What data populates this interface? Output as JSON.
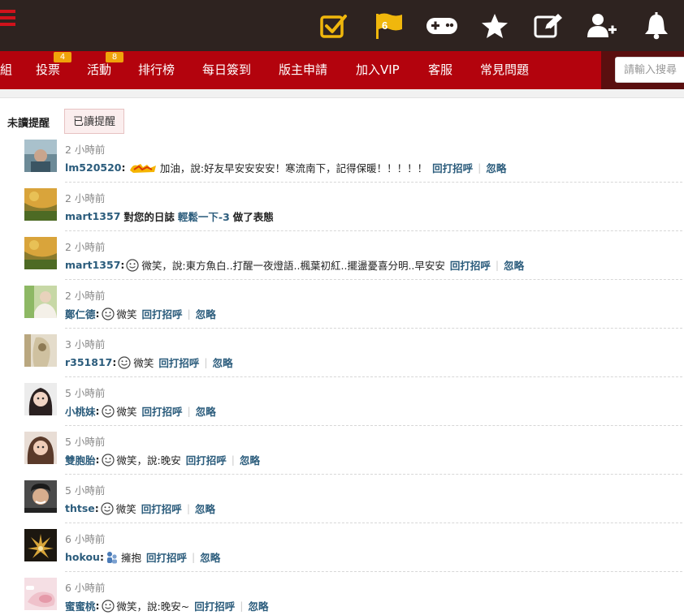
{
  "topbar": {
    "flag_count": "6",
    "icons": [
      "checkbox-icon",
      "flag-icon",
      "gamepad-icon",
      "star-icon",
      "edit-icon",
      "add-user-icon",
      "bell-icon"
    ]
  },
  "nav": {
    "items": [
      {
        "label": "組"
      },
      {
        "label": "投票",
        "badge": "4"
      },
      {
        "label": "活動",
        "badge": "8"
      },
      {
        "label": "排行榜"
      },
      {
        "label": "每日簽到"
      },
      {
        "label": "版主申請"
      },
      {
        "label": "加入VIP"
      },
      {
        "label": "客服"
      },
      {
        "label": "常見問題"
      }
    ],
    "search_placeholder": "請輸入搜尋"
  },
  "tabs": {
    "unread": "未讀提醒",
    "read": "已讀提醒"
  },
  "actions": {
    "reply": "回打招呼",
    "ignore": "忽略"
  },
  "notifications": [
    {
      "time": "2 小時前",
      "user": "lm520520",
      "pre": "",
      "action_icon": "jiayou",
      "text": "加油，說:好友早安安安安！寒流南下，記得保暖！！！！！",
      "has_reply": true
    },
    {
      "time": "2 小時前",
      "user": "mart1357",
      "diary": true,
      "pre": "對您的日誌",
      "diary_link": "輕鬆一下-3",
      "post": "做了表態"
    },
    {
      "time": "2 小時前",
      "user": "mart1357",
      "action_icon": "smile",
      "text": "微笑，說:東方魚白..打醒一夜燈語..楓葉初紅..擺盪憂喜分明..早安安",
      "has_reply": true
    },
    {
      "time": "2 小時前",
      "user": "鄭仁德",
      "action_icon": "smile",
      "text": "微笑",
      "has_reply": true
    },
    {
      "time": "3 小時前",
      "user": "r351817",
      "action_icon": "smile",
      "text": "微笑",
      "has_reply": true
    },
    {
      "time": "5 小時前",
      "user": "小桃妹",
      "action_icon": "smile",
      "text": "微笑",
      "has_reply": true
    },
    {
      "time": "5 小時前",
      "user": "雙胞胎",
      "action_icon": "smile",
      "text": "微笑，說:晚安",
      "has_reply": true
    },
    {
      "time": "5 小時前",
      "user": "thtse",
      "action_icon": "smile",
      "text": "微笑",
      "has_reply": true
    },
    {
      "time": "6 小時前",
      "user": "hokou",
      "action_icon": "hug",
      "text": "擁抱",
      "has_reply": true
    },
    {
      "time": "6 小時前",
      "user": "蜜蜜桃",
      "action_icon": "smile",
      "text": "微笑，說:晚安~",
      "has_reply": true
    }
  ],
  "colors": {
    "topbar": "#2e2320",
    "navbar": "#b3030d",
    "icon_yellow": "#f0b70c",
    "link_blue": "#2b5c7c"
  }
}
